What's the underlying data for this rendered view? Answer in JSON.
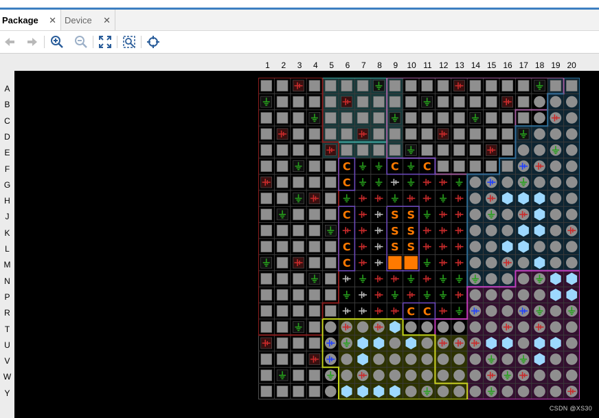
{
  "tabs": [
    {
      "label": "Package",
      "active": true
    },
    {
      "label": "Device",
      "active": false
    }
  ],
  "toolbar": {
    "icons": [
      "back-arrow-icon",
      "forward-arrow-icon",
      "zoom-in-icon",
      "zoom-out-icon",
      "fit-view-icon",
      "zoom-to-selection-icon",
      "crosshair-icon"
    ]
  },
  "package": {
    "columns": [
      "1",
      "2",
      "3",
      "4",
      "5",
      "6",
      "7",
      "8",
      "9",
      "10",
      "11",
      "12",
      "13",
      "14",
      "15",
      "16",
      "17",
      "18",
      "19",
      "20"
    ],
    "rows": [
      "A",
      "B",
      "C",
      "D",
      "E",
      "F",
      "G",
      "H",
      "J",
      "K",
      "L",
      "M",
      "N",
      "P",
      "R",
      "T",
      "U",
      "V",
      "W",
      "Y"
    ],
    "colors": {
      "background": "#000000",
      "cell_grey": "#8f8f8f",
      "ground": "#27a11c",
      "power": "#c92b2b",
      "config_pin": "#ff7a00",
      "clock_pin": "#9dd8ff",
      "bank_outline_left": "#8a1d1d",
      "bank_outline_teal": "#40a8a0",
      "bank_outline_pink": "#a05a9a",
      "bank_outline_blue": "#2e6c94",
      "bank_outline_magenta": "#c23ab8",
      "bank_outline_yellow": "#c2d31a",
      "bank_outline_purple": "#6a48b8"
    },
    "config_labels": [
      "C",
      "S"
    ]
  },
  "watermark": "CSDN @XS30"
}
